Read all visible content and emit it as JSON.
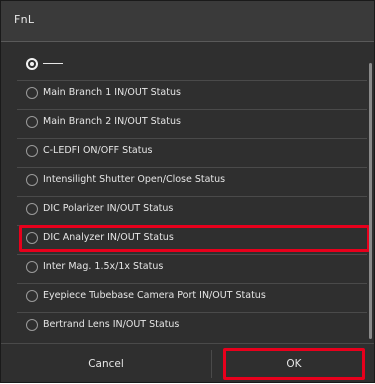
{
  "dialog": {
    "title": "FnL"
  },
  "options": [
    {
      "label": "",
      "selected": true
    },
    {
      "label": "Main Branch 1 IN/OUT Status",
      "selected": false
    },
    {
      "label": "Main Branch 2 IN/OUT Status",
      "selected": false
    },
    {
      "label": "C-LEDFI ON/OFF Status",
      "selected": false
    },
    {
      "label": "Intensilight Shutter Open/Close Status",
      "selected": false
    },
    {
      "label": "DIC Polarizer IN/OUT Status",
      "selected": false
    },
    {
      "label": "DIC Analyzer IN/OUT Status",
      "selected": false,
      "highlighted": true
    },
    {
      "label": "Inter Mag. 1.5x/1x Status",
      "selected": false
    },
    {
      "label": "Eyepiece Tubebase Camera Port IN/OUT Status",
      "selected": false
    },
    {
      "label": "Bertrand Lens IN/OUT Status",
      "selected": false
    }
  ],
  "buttons": {
    "cancel": "Cancel",
    "ok": "OK"
  },
  "colors": {
    "background": "#2f2f2f",
    "text": "#e6e6e6",
    "highlight": "#e8001c"
  }
}
